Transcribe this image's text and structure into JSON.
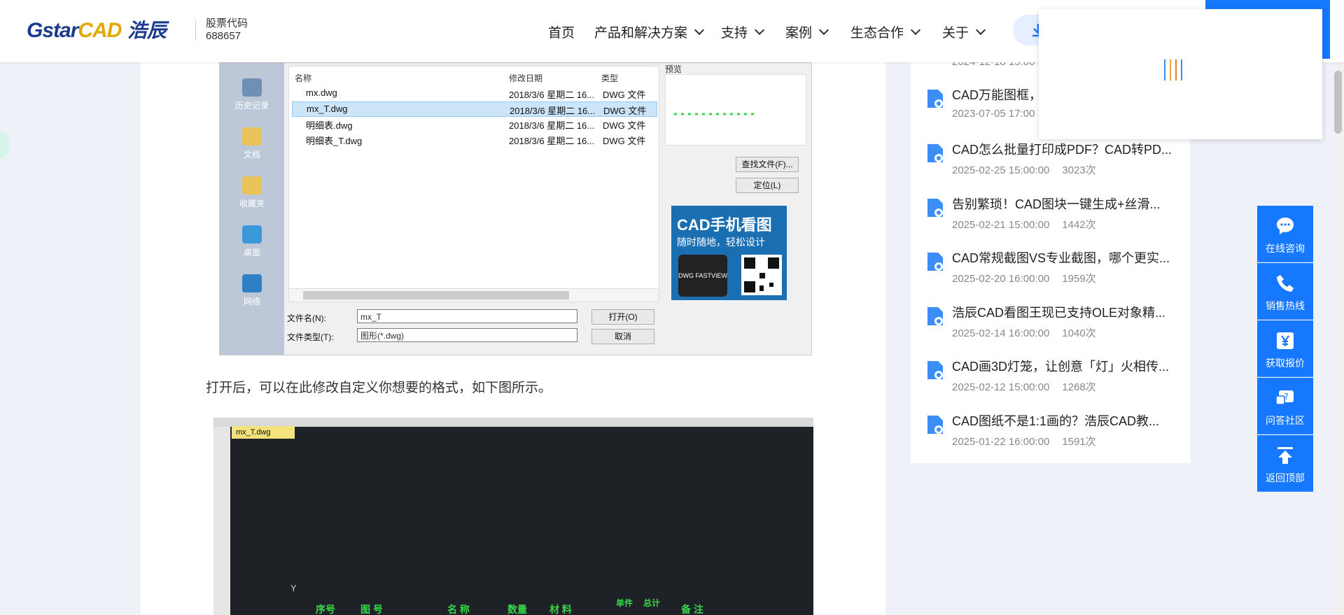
{
  "header": {
    "logo_text_en": "GstarCAD",
    "logo_text_cn": "浩辰",
    "stock_label": "股票代码",
    "stock_code": "688657",
    "nav": [
      {
        "label": "首页",
        "has_dropdown": false
      },
      {
        "label": "产品和解决方案",
        "has_dropdown": true
      },
      {
        "label": "支持",
        "has_dropdown": true
      },
      {
        "label": "案例",
        "has_dropdown": true
      },
      {
        "label": "生态合作",
        "has_dropdown": true
      },
      {
        "label": "关于",
        "has_dropdown": true
      }
    ]
  },
  "dialog": {
    "places": [
      "历史记录",
      "文档",
      "收藏夹",
      "桌面",
      "网络"
    ],
    "columns": [
      "名称",
      "修改日期",
      "类型"
    ],
    "files": [
      {
        "name": "mx.dwg",
        "date": "2018/3/6 星期二 16...",
        "type": "DWG 文件",
        "selected": false
      },
      {
        "name": "mx_T.dwg",
        "date": "2018/3/6 星期二 16...",
        "type": "DWG 文件",
        "selected": true
      },
      {
        "name": "明细表.dwg",
        "date": "2018/3/6 星期二 16...",
        "type": "DWG 文件",
        "selected": false
      },
      {
        "name": "明细表_T.dwg",
        "date": "2018/3/6 星期二 16...",
        "type": "DWG 文件",
        "selected": false
      }
    ],
    "preview_label": "预览",
    "find_button": "查找文件(F)...",
    "locate_button": "定位(L)",
    "ad_title": "CAD手机看图",
    "ad_subtitle": "随时随地，轻松设计",
    "ad_phone_text": "DWG FASTVIEW",
    "filename_label": "文件名(N):",
    "filename_value": "mx_T",
    "filetype_label": "文件类型(T):",
    "filetype_value": "图形(*.dwg)",
    "open_button": "打开(O)",
    "cancel_button": "取消"
  },
  "article": {
    "paragraph": "打开后，可以在此修改自定义你想要的格式，如下图所示。",
    "cad_tab": "mx_T.dwg",
    "cad_axis_label": "Y",
    "cad_table_headers": [
      "序号",
      "图  号",
      "名  称",
      "数量",
      "材  料",
      "单件",
      "总计",
      "备  注"
    ]
  },
  "sidebar": {
    "partial_date": "2024-12-18 15:00",
    "items": [
      {
        "title": "CAD万能图框，",
        "date": "2023-07-05 17:00",
        "views": ""
      },
      {
        "title": "CAD怎么批量打印成PDF？CAD转PD...",
        "date": "2025-02-25 15:00:00",
        "views": "3023次"
      },
      {
        "title": "告别繁琐！CAD图块一键生成+丝滑...",
        "date": "2025-02-21 15:00:00",
        "views": "1442次"
      },
      {
        "title": "CAD常规截图VS专业截图，哪个更实...",
        "date": "2025-02-20 16:00:00",
        "views": "1959次"
      },
      {
        "title": "浩辰CAD看图王现已支持OLE对象精...",
        "date": "2025-02-14 16:00:00",
        "views": "1040次"
      },
      {
        "title": "CAD画3D灯笼，让创意「灯」火相传...",
        "date": "2025-02-12 15:00:00",
        "views": "1268次"
      },
      {
        "title": "CAD图纸不是1:1画的？浩辰CAD教...",
        "date": "2025-01-22 16:00:00",
        "views": "1591次"
      }
    ]
  },
  "service_bar": [
    {
      "label": "在线咨询",
      "icon": "chat-bubble-icon"
    },
    {
      "label": "销售热线",
      "icon": "phone-icon"
    },
    {
      "label": "获取报价",
      "icon": "yuan-icon"
    },
    {
      "label": "问答社区",
      "icon": "question-bubble-icon"
    },
    {
      "label": "返回顶部",
      "icon": "arrow-up-icon"
    }
  ],
  "colors": {
    "brand_blue": "#1677ff",
    "logo_blue": "#1a3a8f",
    "logo_gold": "#e0a800",
    "cad_green": "#37d64a"
  }
}
